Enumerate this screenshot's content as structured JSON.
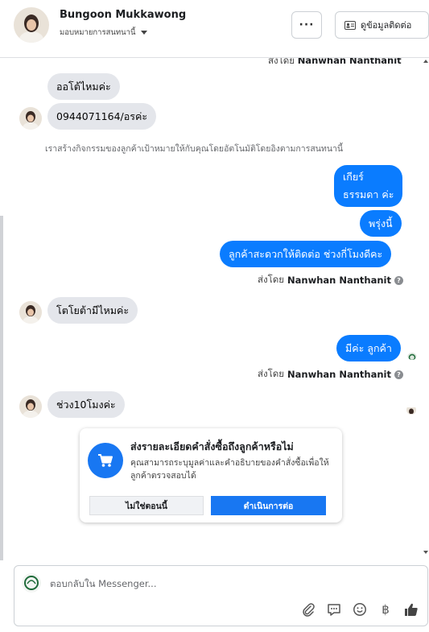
{
  "header": {
    "contact_name": "Bungoon Mukkawong",
    "assign_label": "มอบหมายการสนทนานี้",
    "more_label": "···",
    "contact_info_label": "ดูข้อมูลติดต่อ"
  },
  "chat": {
    "cut_sent_prefix": "ส่งโดย",
    "cut_sent_name": "Nanwhan Nanthanit",
    "messages": [
      {
        "text": "ออโต้ไหมค่ะ"
      },
      {
        "text": "0944071164/อรค่ะ"
      },
      {
        "text": "เกียร์"
      },
      {
        "text": "ธรรมดา ค่ะ"
      },
      {
        "text": "พรุ่งนี้"
      },
      {
        "text": "ลูกค้าสะดวกให้ติดต่อ ช่วงกี่โมงดีคะ"
      },
      {
        "text": "โตโยต้ามีไหมค่ะ"
      },
      {
        "text": "มีค่ะ ลูกค้า"
      },
      {
        "text": "ช่วง10โมงค่ะ"
      }
    ],
    "system_note": "เราสร้างกิจกรรมของลูกค้าเป้าหมายให้กับคุณโดยอัตโนมัติโดยอิงตามการสนทนานี้",
    "sent_by_prefix": "ส่งโดย",
    "sent_by_name": "Nanwhan Nanthanit",
    "help_mark": "?"
  },
  "card": {
    "title": "ส่งรายละเอียดคำสั่งซื้อถึงลูกค้าหรือไม่",
    "description": "คุณสามารถระบุมูลค่าและคำอธิบายของคำสั่งซื้อเพื่อให้ลูกค้าตรวจสอบได้",
    "decline_label": "ไม่ใช่ตอนนี้",
    "accept_label": "ดำเนินการต่อ",
    "icon": "cart-icon"
  },
  "composer": {
    "placeholder": "ตอบกลับใน Messenger...",
    "icons": [
      "attach-icon",
      "quick-reply-icon",
      "emoji-icon",
      "payment-icon",
      "like-icon"
    ],
    "currency_symbol": "฿"
  },
  "colors": {
    "outgoing_bubble": "#0a7cff",
    "incoming_bubble": "#e4e6eb",
    "primary_button": "#1877f2"
  }
}
